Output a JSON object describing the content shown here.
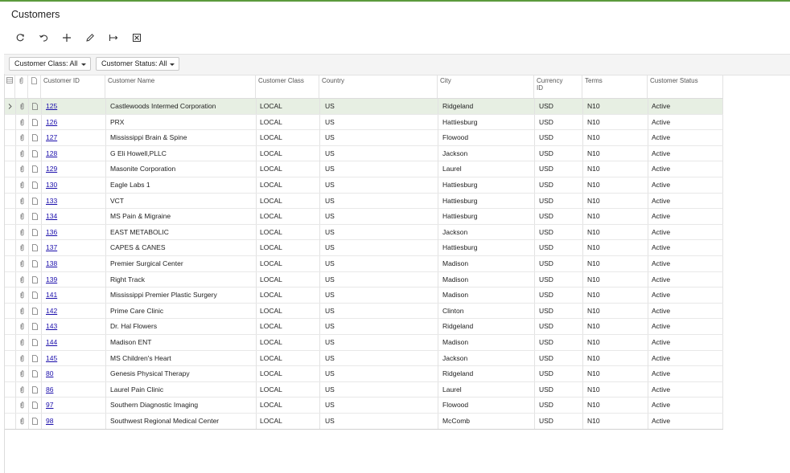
{
  "page": {
    "title": "Customers"
  },
  "toolbar": [
    {
      "name": "refresh-button",
      "icon": "refresh-icon"
    },
    {
      "name": "undo-button",
      "icon": "undo-icon"
    },
    {
      "name": "add-button",
      "icon": "plus-icon"
    },
    {
      "name": "edit-button",
      "icon": "pencil-icon"
    },
    {
      "name": "fit-columns-button",
      "icon": "fit-width-icon"
    },
    {
      "name": "export-excel-button",
      "icon": "excel-icon"
    }
  ],
  "filters": {
    "customer_class": "Customer Class: All",
    "customer_status": "Customer Status: All"
  },
  "columns": {
    "customer_id": "Customer ID",
    "customer_name": "Customer Name",
    "customer_class": "Customer Class",
    "country": "Country",
    "city": "City",
    "currency_id_1": "Currency",
    "currency_id_2": "ID",
    "terms": "Terms",
    "customer_status": "Customer Status"
  },
  "rows": [
    {
      "id": "125",
      "name": "Castlewoods Intermed Corporation",
      "class": "LOCAL",
      "country": "US",
      "city": "Ridgeland",
      "currency": "USD",
      "terms": "N10",
      "status": "Active"
    },
    {
      "id": "126",
      "name": "PRX",
      "class": "LOCAL",
      "country": "US",
      "city": "Hattiesburg",
      "currency": "USD",
      "terms": "N10",
      "status": "Active"
    },
    {
      "id": "127",
      "name": "Mississippi Brain & Spine",
      "class": "LOCAL",
      "country": "US",
      "city": "Flowood",
      "currency": "USD",
      "terms": "N10",
      "status": "Active"
    },
    {
      "id": "128",
      "name": "G Eli Howell,PLLC",
      "class": "LOCAL",
      "country": "US",
      "city": "Jackson",
      "currency": "USD",
      "terms": "N10",
      "status": "Active"
    },
    {
      "id": "129",
      "name": "Masonite Corporation",
      "class": "LOCAL",
      "country": "US",
      "city": "Laurel",
      "currency": "USD",
      "terms": "N10",
      "status": "Active"
    },
    {
      "id": "130",
      "name": "Eagle Labs 1",
      "class": "LOCAL",
      "country": "US",
      "city": "Hattiesburg",
      "currency": "USD",
      "terms": "N10",
      "status": "Active"
    },
    {
      "id": "133",
      "name": "VCT",
      "class": "LOCAL",
      "country": "US",
      "city": "Hattiesburg",
      "currency": "USD",
      "terms": "N10",
      "status": "Active"
    },
    {
      "id": "134",
      "name": "MS Pain & Migraine",
      "class": "LOCAL",
      "country": "US",
      "city": "Hattiesburg",
      "currency": "USD",
      "terms": "N10",
      "status": "Active"
    },
    {
      "id": "136",
      "name": "EAST METABOLIC",
      "class": "LOCAL",
      "country": "US",
      "city": "Jackson",
      "currency": "USD",
      "terms": "N10",
      "status": "Active"
    },
    {
      "id": "137",
      "name": "CAPES & CANES",
      "class": "LOCAL",
      "country": "US",
      "city": "Hattiesburg",
      "currency": "USD",
      "terms": "N10",
      "status": "Active"
    },
    {
      "id": "138",
      "name": "Premier Surgical Center",
      "class": "LOCAL",
      "country": "US",
      "city": "Madison",
      "currency": "USD",
      "terms": "N10",
      "status": "Active"
    },
    {
      "id": "139",
      "name": "Right Track",
      "class": "LOCAL",
      "country": "US",
      "city": "Madison",
      "currency": "USD",
      "terms": "N10",
      "status": "Active"
    },
    {
      "id": "141",
      "name": "Mississippi Premier Plastic Surgery",
      "class": "LOCAL",
      "country": "US",
      "city": "Madison",
      "currency": "USD",
      "terms": "N10",
      "status": "Active"
    },
    {
      "id": "142",
      "name": "Prime Care Clinic",
      "class": "LOCAL",
      "country": "US",
      "city": "Clinton",
      "currency": "USD",
      "terms": "N10",
      "status": "Active"
    },
    {
      "id": "143",
      "name": "Dr. Hal Flowers",
      "class": "LOCAL",
      "country": "US",
      "city": "Ridgeland",
      "currency": "USD",
      "terms": "N10",
      "status": "Active"
    },
    {
      "id": "144",
      "name": "Madison ENT",
      "class": "LOCAL",
      "country": "US",
      "city": "Madison",
      "currency": "USD",
      "terms": "N10",
      "status": "Active"
    },
    {
      "id": "145",
      "name": "MS Children's Heart",
      "class": "LOCAL",
      "country": "US",
      "city": "Jackson",
      "currency": "USD",
      "terms": "N10",
      "status": "Active"
    },
    {
      "id": "80",
      "name": "Genesis Physical Therapy",
      "class": "LOCAL",
      "country": "US",
      "city": "Ridgeland",
      "currency": "USD",
      "terms": "N10",
      "status": "Active"
    },
    {
      "id": "86",
      "name": "Laurel Pain Clinic",
      "class": "LOCAL",
      "country": "US",
      "city": "Laurel",
      "currency": "USD",
      "terms": "N10",
      "status": "Active"
    },
    {
      "id": "97",
      "name": "Southern Diagnostic Imaging",
      "class": "LOCAL",
      "country": "US",
      "city": "Flowood",
      "currency": "USD",
      "terms": "N10",
      "status": "Active"
    },
    {
      "id": "98",
      "name": "Southwest Regional Medical Center",
      "class": "LOCAL",
      "country": "US",
      "city": "McComb",
      "currency": "USD",
      "terms": "N10",
      "status": "Active"
    }
  ]
}
